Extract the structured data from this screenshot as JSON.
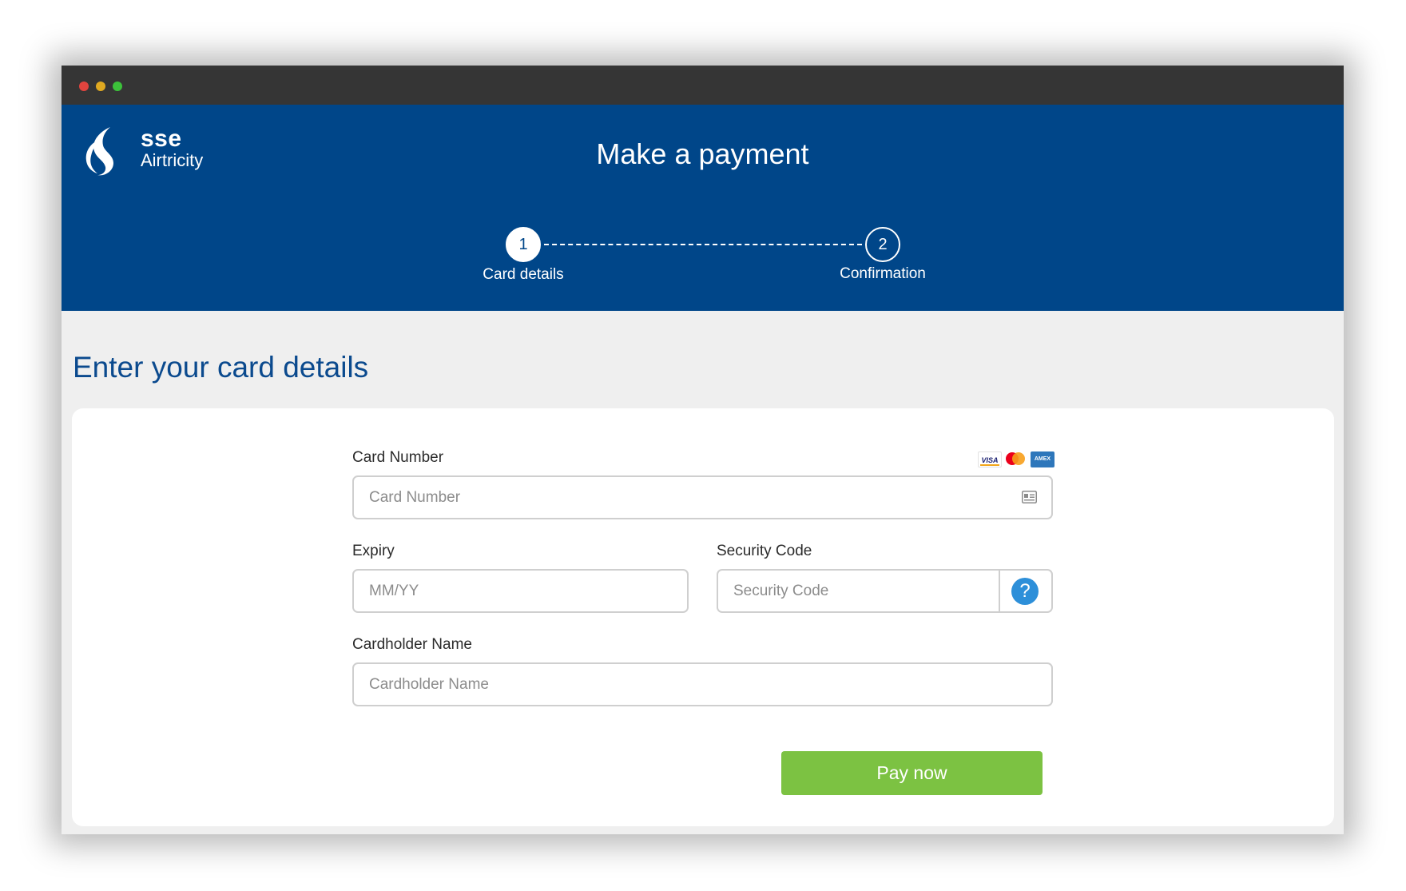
{
  "colors": {
    "header_bg": "#004689",
    "titlebar_bg": "#353535",
    "page_bg": "#efefef",
    "section_title": "#0b4a8e",
    "pay_button": "#7cc242",
    "help_icon": "#2d8fd9",
    "traffic_lights": [
      "#e0443e",
      "#e0a921",
      "#3cc23a"
    ]
  },
  "window": {
    "controls": [
      "close",
      "minimize",
      "maximize"
    ]
  },
  "brand": {
    "name_top": "sse",
    "name_bottom": "Airtricity",
    "icon": "sse-swirl-logo-icon"
  },
  "header": {
    "title": "Make a payment"
  },
  "stepper": {
    "steps": [
      {
        "number": "1",
        "label": "Card details",
        "state": "active"
      },
      {
        "number": "2",
        "label": "Confirmation",
        "state": "inactive"
      }
    ]
  },
  "section": {
    "title": "Enter your card details"
  },
  "form": {
    "card_number": {
      "label": "Card Number",
      "placeholder": "Card Number",
      "value": "",
      "icon": "id-card-icon",
      "accepted_cards": [
        "visa-icon",
        "mastercard-icon",
        "amex-icon"
      ],
      "visa_text": "VISA",
      "amex_text": "AMEX"
    },
    "expiry": {
      "label": "Expiry",
      "placeholder": "MM/YY",
      "value": ""
    },
    "security_code": {
      "label": "Security Code",
      "placeholder": "Security Code",
      "value": "",
      "help_glyph": "?"
    },
    "cardholder_name": {
      "label": "Cardholder Name",
      "placeholder": "Cardholder Name",
      "value": ""
    },
    "submit_label": "Pay now"
  }
}
